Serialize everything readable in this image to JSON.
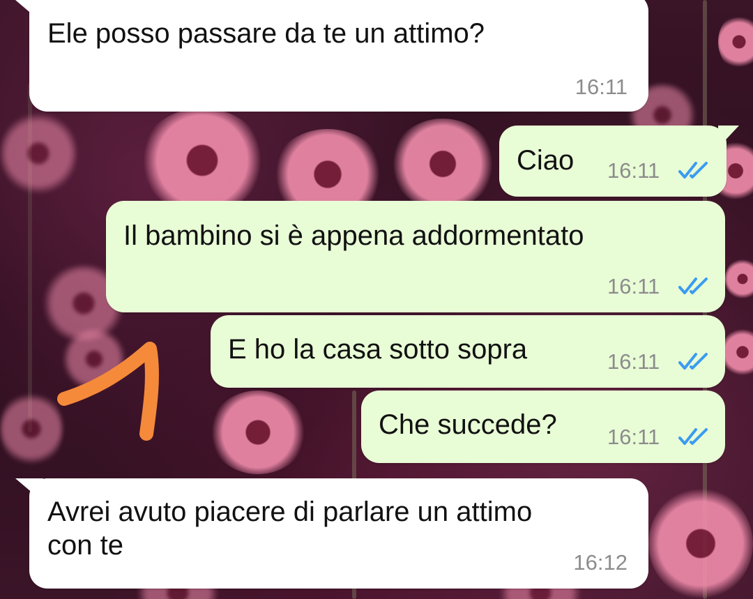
{
  "chat": {
    "messages": [
      {
        "direction": "incoming",
        "text": "Ele posso passare da te un attimo?",
        "time": "16:11"
      },
      {
        "direction": "outgoing",
        "text": "Ciao",
        "time": "16:11",
        "status": "read"
      },
      {
        "direction": "outgoing",
        "text": "Il bambino si è appena addormentato",
        "time": "16:11",
        "status": "read"
      },
      {
        "direction": "outgoing",
        "text": "E ho la casa sotto sopra",
        "time": "16:11",
        "status": "read"
      },
      {
        "direction": "outgoing",
        "text": "Che succede?",
        "time": "16:11",
        "status": "read"
      },
      {
        "direction": "incoming",
        "text": "Avrei avuto piacere di parlare un attimo\ncon te",
        "time": "16:12"
      }
    ]
  },
  "colors": {
    "incoming_bubble": "#ffffff",
    "outgoing_bubble": "#e8fcd6",
    "read_ticks": "#3b9bf0",
    "timestamp": "#8c8c8c",
    "annotation_arrow": "#f58a3a"
  },
  "icons": {
    "read_receipt": "double-check-icon",
    "annotation": "orange-hand-drawn-arrow"
  }
}
